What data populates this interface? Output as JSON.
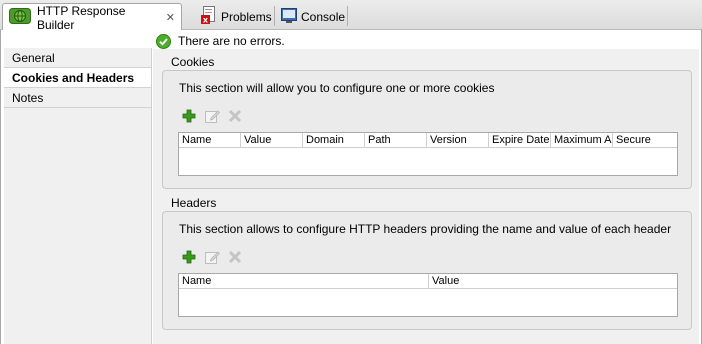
{
  "tabs": [
    {
      "label": "HTTP Response Builder",
      "icon": "globe-icon",
      "active": true,
      "close": "✕"
    },
    {
      "label": "Problems",
      "icon": "problems-icon",
      "active": false
    },
    {
      "label": "Console",
      "icon": "console-icon",
      "active": false
    }
  ],
  "status": {
    "message": "There are no errors."
  },
  "sidebar": {
    "items": [
      {
        "label": "General",
        "selected": false
      },
      {
        "label": "Cookies and Headers",
        "selected": true
      },
      {
        "label": "Notes",
        "selected": false
      }
    ]
  },
  "cookies": {
    "title": "Cookies",
    "description": "This section will allow you to configure one or more cookies",
    "columns": [
      "Name",
      "Value",
      "Domain",
      "Path",
      "Version",
      "Expire Date",
      "Maximum Age",
      "Secure"
    ],
    "rows": []
  },
  "headers": {
    "title": "Headers",
    "description": "This section allows to configure HTTP headers providing the name and value of each header",
    "columns": [
      "Name",
      "Value"
    ],
    "rows": []
  },
  "colors": {
    "accent_green": "#3a9a1e",
    "ok_green": "#4caf2a"
  }
}
